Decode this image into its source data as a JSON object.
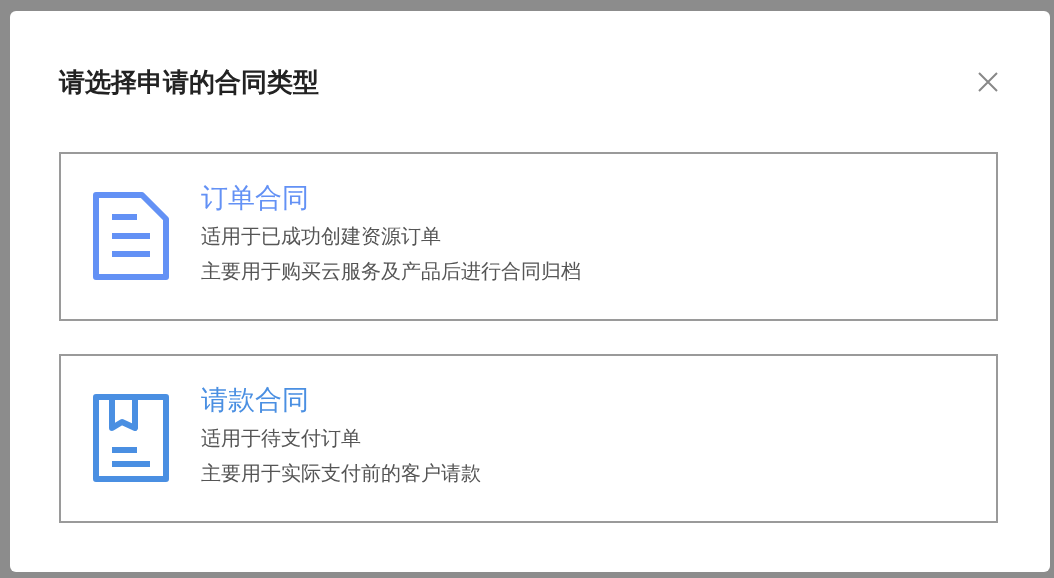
{
  "dialog": {
    "title": "请选择申请的合同类型"
  },
  "options": [
    {
      "kind": "order",
      "color": "#6391f5",
      "title": "订单合同",
      "lines": [
        "适用于已成功创建资源订单",
        "主要用于购买云服务及产品后进行合同归档"
      ]
    },
    {
      "kind": "payment",
      "color": "#4a8fe2",
      "title": "请款合同",
      "lines": [
        "适用于待支付订单",
        "主要用于实际支付前的客户请款"
      ]
    }
  ]
}
